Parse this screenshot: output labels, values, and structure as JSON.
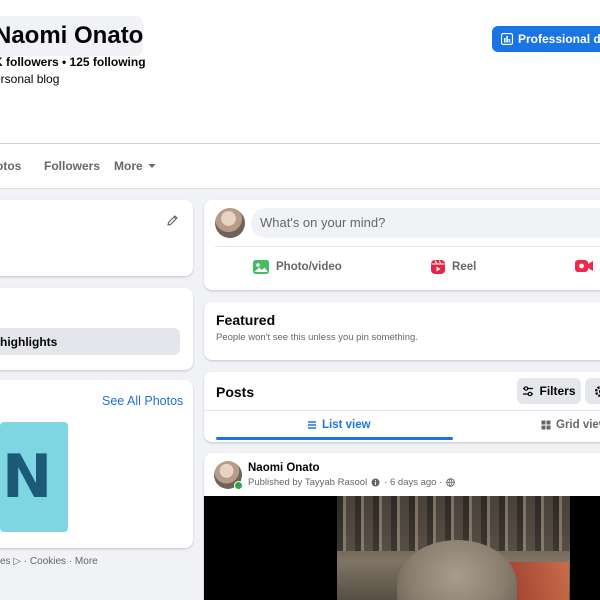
{
  "profile": {
    "name": "Naomi Onato",
    "stats": "K followers • 125 following",
    "category": "ersonal blog",
    "professional_dashboard_label": "Professional dash"
  },
  "tabs": [
    {
      "label": "otos"
    },
    {
      "label": "Followers"
    },
    {
      "label": "More"
    }
  ],
  "left_column": {
    "highlights_label": "highlights",
    "see_all_photos": "See All Photos",
    "photo_letter": "N",
    "footer": "es ▷ · Cookies · More"
  },
  "composer": {
    "placeholder": "What's on your mind?",
    "actions": [
      {
        "label": "Photo/video",
        "icon": "photo-video-icon",
        "color": "#45bd62"
      },
      {
        "label": "Reel",
        "icon": "reel-icon",
        "color": "#e42645"
      },
      {
        "label": "",
        "icon": "live-video-icon",
        "color": "#f02849"
      }
    ]
  },
  "featured": {
    "title": "Featured",
    "subtitle": "People won't see this unless you pin something."
  },
  "posts": {
    "title": "Posts",
    "filters_label": "Filters",
    "list_view_label": "List view",
    "grid_view_label": "Grid view"
  },
  "post": {
    "author": "Naomi Onato",
    "meta": "Published by Tayyab Rasool",
    "time": "· 6 days ago ·"
  },
  "colors": {
    "accent": "#1b74e4",
    "link": "#216fdb",
    "background": "#f0f2f5",
    "online": "#31a24c"
  }
}
